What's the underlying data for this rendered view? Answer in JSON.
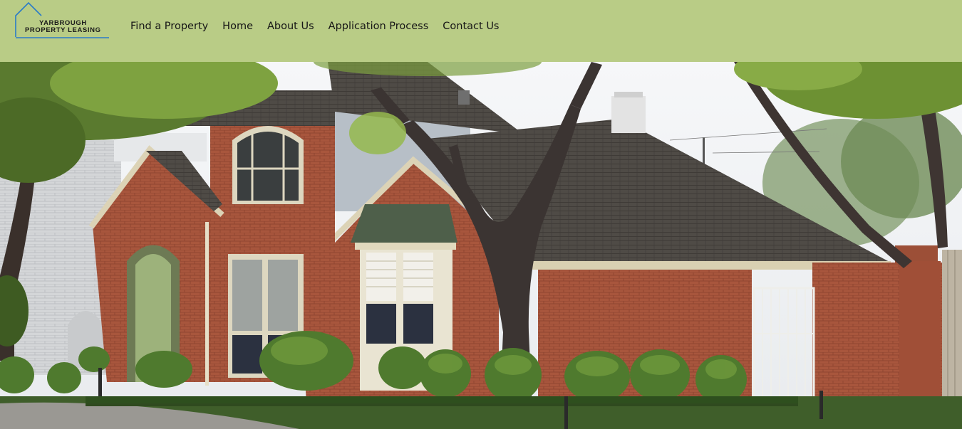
{
  "brand": {
    "line1": "YARBROUGH",
    "line2": "PROPERTY LEASING",
    "accent_color": "#2a7bc8"
  },
  "nav": {
    "items": [
      {
        "label": "Find a Property"
      },
      {
        "label": "Home"
      },
      {
        "label": "About Us"
      },
      {
        "label": "Application Process"
      },
      {
        "label": "Contact Us"
      }
    ]
  },
  "colors": {
    "header_bg": "#b9cc86"
  },
  "hero": {
    "image_subject": "brick-house-photo"
  }
}
